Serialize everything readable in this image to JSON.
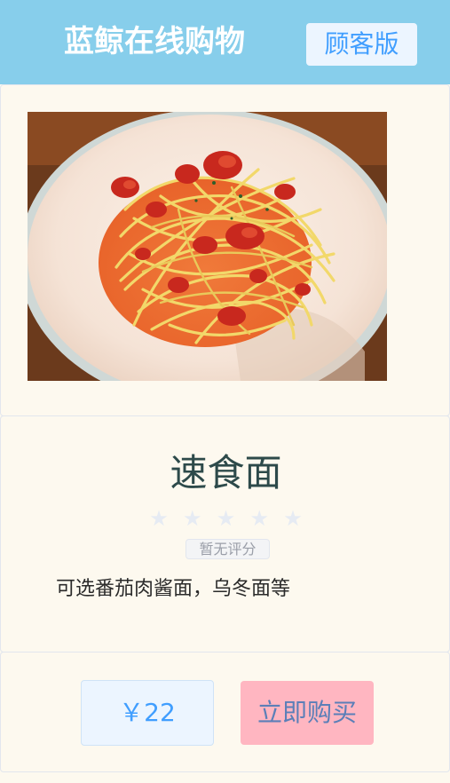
{
  "header": {
    "title": "蓝鲸在线购物",
    "version_label": "顾客版"
  },
  "product": {
    "name": "速食面",
    "rating_stars": 0,
    "rating_max": 5,
    "rating_label": "暂无评分",
    "description": "可选番茄肉酱面，乌冬面等",
    "price": "￥22",
    "buy_label": "立即购买"
  },
  "colors": {
    "header_bg": "#87ceeb",
    "page_bg": "#fdf9ef",
    "accent_blue": "#409eff",
    "buy_button_bg": "#ffb6c1"
  },
  "icons": {
    "star": "star-icon"
  }
}
